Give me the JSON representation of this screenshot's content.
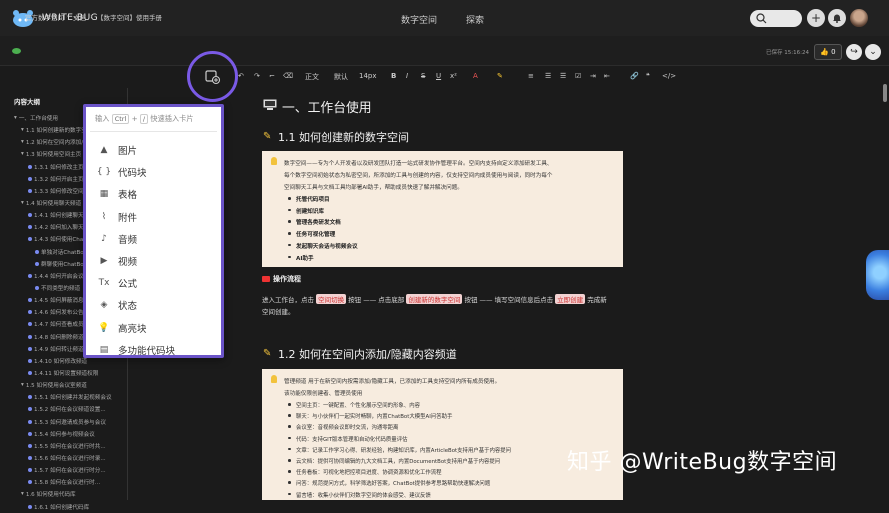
{
  "header": {
    "brand": "WRITE-BUG",
    "nav": [
      "数字空间",
      "探索"
    ],
    "search_placeholder": ""
  },
  "breadcrumb": [
    "官方数字空间",
    "文档",
    "【数字空间】使用手册"
  ],
  "status": {
    "saved_text": "已保存 15:16:24",
    "like_count": "0"
  },
  "toolbar": {
    "style": "正文",
    "font": "默认",
    "size": "14px",
    "bold": "B",
    "italic": "I",
    "strike": "S",
    "underline": "U"
  },
  "sidebar": {
    "title": "内容大纲",
    "items": [
      "一、工作台使用",
      "1.1 如何创建新的数字空间",
      "1.2 如何在空间内添加/隐藏内容",
      "1.3 如何使用空间主页",
      "1.3.1 如何修改主页组件",
      "1.3.2 如何开启主页功能",
      "1.3.3 如何修改空间信息",
      "1.4 如何使用聊天频道",
      "1.4.1 如何创建聊天频道",
      "1.4.2 如何加入聊天频道",
      "1.4.3 如何使用ChatBot",
      "单独对话ChatBot",
      "群聊使用ChatBot",
      "1.4.4 如何开启会议",
      "不同类型的频道",
      "1.4.5 如何屏蔽消息",
      "1.4.6 如何发布公告",
      "1.4.7 如何查看成员",
      "1.4.8 如何删除频道",
      "1.4.9 如何转让频道",
      "1.4.10 如何修改频道",
      "1.4.11 如何设置频道权限",
      "1.5 如何使用会议室频道",
      "1.5.1 如何创建并发起视频会议",
      "1.5.2 如何在会议频道设置...",
      "1.5.3 如何邀请成员参与会议",
      "1.5.4 如何参与视频会议",
      "1.5.5 如何在会议进行时共...",
      "1.5.6 如何在会议进行时录...",
      "1.5.7 如何在会议进行时分...",
      "1.5.8 如何在会议进行时...",
      "1.6 如何使用代码库",
      "1.6.1 如何创建代码库"
    ]
  },
  "insert_popup": {
    "hint_prefix": "输入",
    "hint_key1": "Ctrl",
    "hint_plus": "+",
    "hint_key2": "/",
    "hint_suffix": "快速插入卡片",
    "items": [
      {
        "icon": "image-icon",
        "label": "图片"
      },
      {
        "icon": "code-block-icon",
        "label": "代码块"
      },
      {
        "icon": "table-icon",
        "label": "表格"
      },
      {
        "icon": "attachment-icon",
        "label": "附件"
      },
      {
        "icon": "audio-icon",
        "label": "音频"
      },
      {
        "icon": "video-icon",
        "label": "视频"
      },
      {
        "icon": "formula-icon",
        "label": "公式"
      },
      {
        "icon": "status-icon",
        "label": "状态"
      },
      {
        "icon": "highlight-icon",
        "label": "高亮块"
      },
      {
        "icon": "multi-code-icon",
        "label": "多功能代码块"
      }
    ]
  },
  "document": {
    "h1": "一、工作台使用",
    "s1_title": "1.1 如何创建新的数字空间",
    "s1_callout": {
      "line1": "数字空间——专为个人开发者以及研发团队打造一站式研发协作管理平台。空间内支持自定义添加研发工具、",
      "line2": "每个数字空间初始状态为私密空间，所添加的工具与创建的内容，仅支持空间内成员使用与阅读，同时为每个",
      "line3": "空间聊天工具与文档工具均部署AI助手，帮助成员快速了解并解决问题。",
      "bullets": [
        "托管代码项目",
        "创建知识库",
        "管理各类研发文档",
        "任务可视化管理",
        "发起聊天会话与视频会议",
        "AI助手"
      ]
    },
    "op_title": "操作流程",
    "op_line1_a": "进入工作台，点击",
    "op_tag1": "空间切换",
    "op_line1_b": "按钮 —— 点击底部",
    "op_tag2": "创建新的数字空间",
    "op_line1_c": "按钮 —— 填写空间信息后点击",
    "op_tag3": "立即创建",
    "op_line1_d": "完成新",
    "op_line2": "空间创建。",
    "s2_title": "1.2 如何在空间内添加/隐藏内容频道",
    "s2_callout": {
      "line1": "管理频道 用于在新空间内按需添加/隐藏工具，已添加的工具支持空间内所有成员使用。",
      "line2": "该功能仅限创建者、管理员使用",
      "bullets": [
        "空间主页：一键配置、个性化展示空间的形象、内容",
        "聊天：与小伙伴们一起实时畅聊，内置ChatBot大模型AI问答助手",
        "会议室：音视频会议即时交流，沟通零距离",
        "代码：支持GIT版本管理和自动化代码质量评估",
        "文章：记录工作学习心得、研发经验，构建知识库，内置ArticleBot支持用户基于内容提问",
        "云文档：提供可协同编辑的九大文档工具，内置DocumentBot支持用户基于内容提问",
        "任务看板：可视化地把控项目进度、协调资源和优化工作流程",
        "问答：规范提问方式，科学筛选好答案，ChatBot提供参考思路帮助快速解决问题",
        "留言墙：收集小伙伴们对数字空间的体会感受、建议反馈"
      ]
    }
  },
  "watermark": "知乎 @WriteBug数字空间"
}
